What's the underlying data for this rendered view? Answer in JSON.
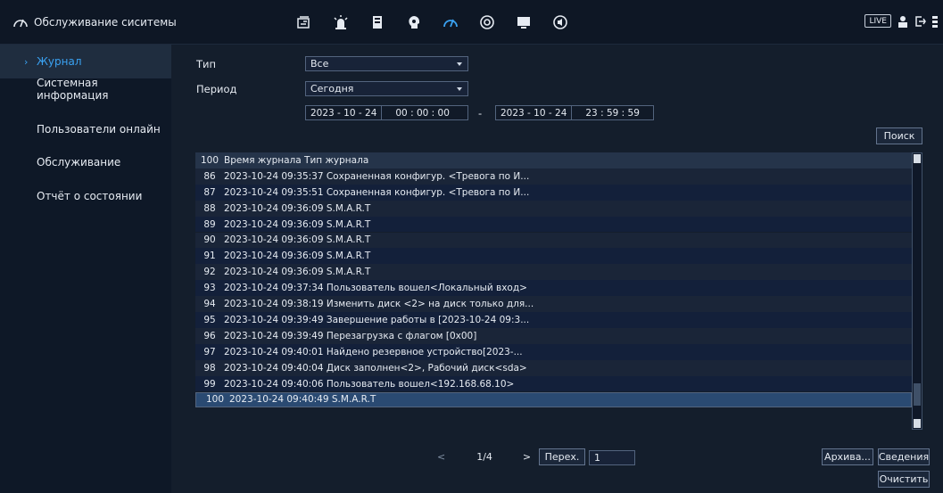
{
  "header": {
    "title": "Обслуживание сиситемы",
    "live_label": "LIVE",
    "nav_icons": [
      "camera-icon",
      "alarm-icon",
      "storage-icon",
      "ai-icon",
      "maintenance-icon",
      "backup-icon",
      "display-icon",
      "audio-icon"
    ],
    "accent": "#3aa2f2"
  },
  "sidebar": {
    "items": [
      {
        "label": "Журнал",
        "active": true
      },
      {
        "label": "Системная информация"
      },
      {
        "label": "Пользователи онлайн"
      },
      {
        "label": "Обслуживание"
      },
      {
        "label": "Отчёт о состоянии"
      }
    ]
  },
  "filters": {
    "type_label": "Тип",
    "type_value": "Все",
    "period_label": "Период",
    "period_value": "Сегодня",
    "start_date": "2023 - 10 - 24",
    "start_time": "00 : 00 : 00",
    "dash": "-",
    "end_date": "2023 - 10 - 24",
    "end_time": "23 : 59 : 59",
    "search_button": "Поиск"
  },
  "table": {
    "header": {
      "num": "100",
      "text": "Время журнала  Тип журнала"
    },
    "rows": [
      {
        "num": "86",
        "text": "2023-10-24 09:35:37  Сохраненная конфигур. <Тревога по И..."
      },
      {
        "num": "87",
        "text": "2023-10-24 09:35:51  Сохраненная конфигур. <Тревога по И..."
      },
      {
        "num": "88",
        "text": "2023-10-24 09:36:09  S.M.A.R.T"
      },
      {
        "num": "89",
        "text": "2023-10-24 09:36:09  S.M.A.R.T"
      },
      {
        "num": "90",
        "text": "2023-10-24 09:36:09  S.M.A.R.T"
      },
      {
        "num": "91",
        "text": "2023-10-24 09:36:09  S.M.A.R.T"
      },
      {
        "num": "92",
        "text": "2023-10-24 09:36:09  S.M.A.R.T"
      },
      {
        "num": "93",
        "text": "2023-10-24 09:37:34  Пользователь вошел<Локальный вход>"
      },
      {
        "num": "94",
        "text": "2023-10-24 09:38:19  Изменить диск <2> на диск только для..."
      },
      {
        "num": "95",
        "text": "2023-10-24 09:39:49  Завершение работы в [2023-10-24 09:3..."
      },
      {
        "num": "96",
        "text": "2023-10-24 09:39:49  Перезагрузка с флагом [0x00]"
      },
      {
        "num": "97",
        "text": "2023-10-24 09:40:01  Найдено резервное устройство[2023-..."
      },
      {
        "num": "98",
        "text": "2023-10-24 09:40:04  Диск заполнен<2>, Рабочий диск<sda>"
      },
      {
        "num": "99",
        "text": "2023-10-24 09:40:06  Пользователь вошел<192.168.68.10>"
      },
      {
        "num": "100",
        "text": "2023-10-24 09:40:49  S.M.A.R.T",
        "selected": true
      }
    ]
  },
  "pager": {
    "prev": "<",
    "page": "1/4",
    "next": ">",
    "goto_button": "Перех.",
    "goto_value": "1"
  },
  "actions": {
    "archive": "Архива...",
    "details": "Сведения",
    "clear": "Очистить"
  }
}
